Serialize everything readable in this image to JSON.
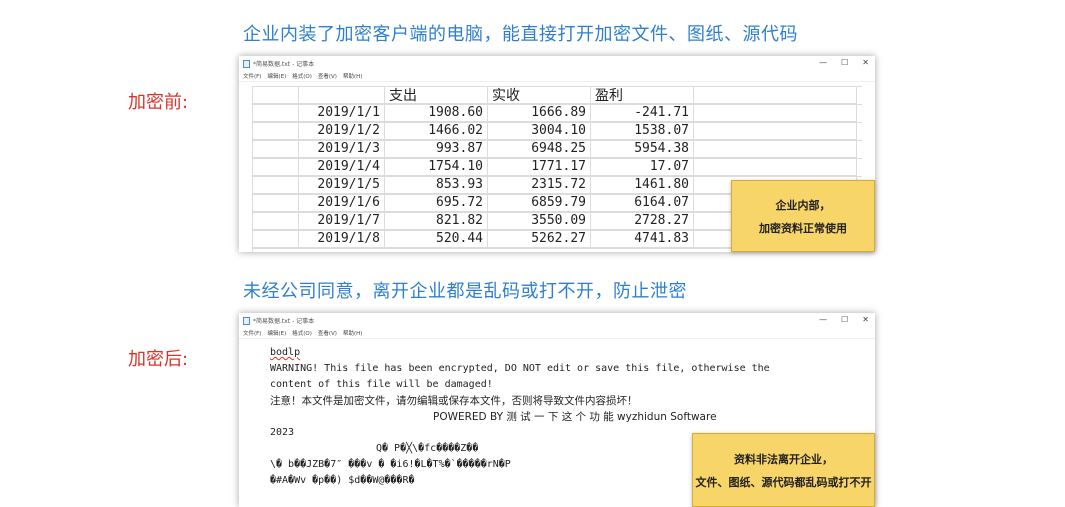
{
  "headings": {
    "top": "企业内装了加密客户端的电脑，能直接打开加密文件、图纸、源代码",
    "middle": "未经公司同意，离开企业都是乱码或打不开，防止泄密"
  },
  "labels": {
    "before": "加密前:",
    "after": "加密后:"
  },
  "window_before": {
    "title": "*简易数据.txt - 记事本",
    "menu": [
      "文件(F)",
      "编辑(E)",
      "格式(O)",
      "查看(V)",
      "帮助(H)"
    ],
    "controls": [
      "—",
      "☐",
      "✕"
    ],
    "table": {
      "headers": [
        "",
        "支出",
        "实收",
        "盈利"
      ],
      "rows": [
        [
          "2019/1/1",
          "1908.60",
          "1666.89",
          "-241.71"
        ],
        [
          "2019/1/2",
          "1466.02",
          "3004.10",
          "1538.07"
        ],
        [
          "2019/1/3",
          "993.87",
          "6948.25",
          "5954.38"
        ],
        [
          "2019/1/4",
          "1754.10",
          "1771.17",
          "17.07"
        ],
        [
          "2019/1/5",
          "853.93",
          "2315.72",
          "1461.80"
        ],
        [
          "2019/1/6",
          "695.72",
          "6859.79",
          "6164.07"
        ],
        [
          "2019/1/7",
          "821.82",
          "3550.09",
          "2728.27"
        ],
        [
          "2019/1/8",
          "520.44",
          "5262.27",
          "4741.83"
        ]
      ]
    }
  },
  "note_before": {
    "line1": "企业内部，",
    "line2": "加密资料正常使用"
  },
  "window_after": {
    "title": "*简易数据.txt - 记事本",
    "menu": [
      "文件(F)",
      "编辑(E)",
      "格式(O)",
      "查看(V)",
      "帮助(H)"
    ],
    "controls": [
      "—",
      "☐",
      "✕"
    ],
    "content": {
      "line1": "bodlp",
      "line2": "WARNING! This file has been encrypted, DO NOT edit or save this file, otherwise the",
      "line3": "content of this file will be damaged!",
      "line4": "注意！本文件是加密文件，请勿编辑或保存本文件，否则将导致文件内容损坏！",
      "line5": "POWERED  BY  测 试 一 下 这 个 功 能  wyzhidun  Software",
      "line6": "2023",
      "line7": "Q�  P�╳\\�fc����Z��",
      "line8": "\\�  b��JZB�7″  ���v  �  �i6!�L�T%�`�����rN�P",
      "line9": "�#A�Wv  �p��)  $d��W@���R�"
    }
  },
  "note_after": {
    "line1": "资料非法离开企业，",
    "line2": "文件、图纸、源代码都乱码或打不开"
  }
}
